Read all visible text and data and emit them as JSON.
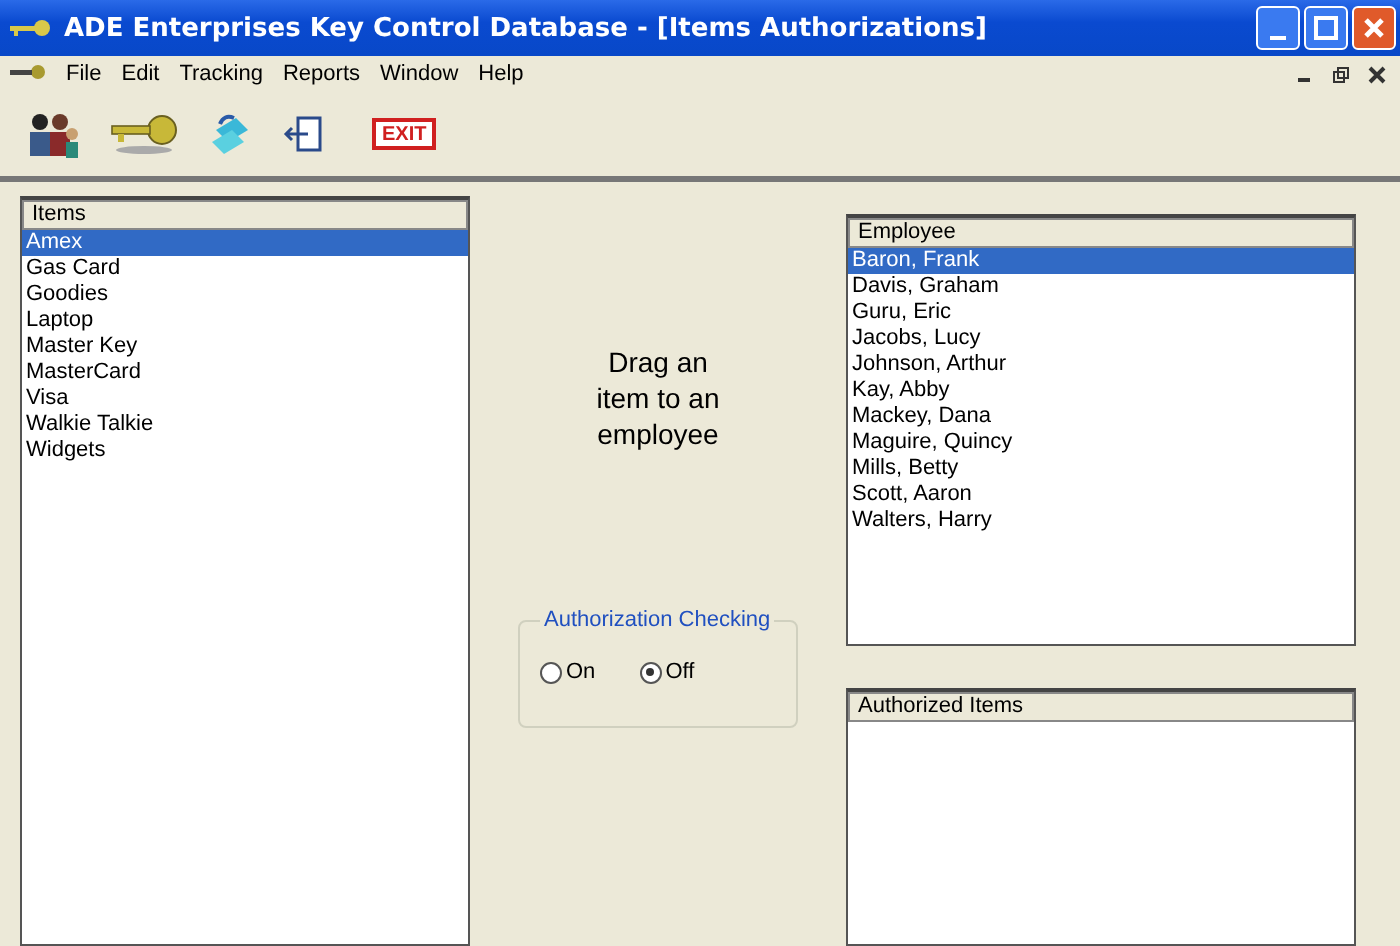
{
  "window": {
    "title": "ADE Enterprises Key Control Database - [Items Authorizations]"
  },
  "menu": [
    "File",
    "Edit",
    "Tracking",
    "Reports",
    "Window",
    "Help"
  ],
  "items": {
    "header": "Items",
    "rows": [
      {
        "label": "Amex",
        "selected": true
      },
      {
        "label": "Gas Card",
        "selected": false
      },
      {
        "label": "Goodies",
        "selected": false
      },
      {
        "label": "Laptop",
        "selected": false
      },
      {
        "label": "Master Key",
        "selected": false
      },
      {
        "label": "MasterCard",
        "selected": false
      },
      {
        "label": "Visa",
        "selected": false
      },
      {
        "label": "Walkie Talkie",
        "selected": false
      },
      {
        "label": "Widgets",
        "selected": false
      }
    ]
  },
  "instruction": "Drag an item to an employee",
  "authorization_checking": {
    "title": "Authorization Checking",
    "options": [
      {
        "label": "On",
        "selected": false
      },
      {
        "label": "Off",
        "selected": true
      }
    ]
  },
  "employees": {
    "header": "Employee",
    "rows": [
      {
        "label": "Baron, Frank",
        "selected": true
      },
      {
        "label": "Davis, Graham",
        "selected": false
      },
      {
        "label": "Guru, Eric",
        "selected": false
      },
      {
        "label": "Jacobs, Lucy",
        "selected": false
      },
      {
        "label": "Johnson, Arthur",
        "selected": false
      },
      {
        "label": "Kay, Abby",
        "selected": false
      },
      {
        "label": "Mackey, Dana",
        "selected": false
      },
      {
        "label": "Maguire, Quincy",
        "selected": false
      },
      {
        "label": "Mills, Betty",
        "selected": false
      },
      {
        "label": "Scott, Aaron",
        "selected": false
      },
      {
        "label": "Walters, Harry",
        "selected": false
      }
    ]
  },
  "authorized_items": {
    "header": "Authorized Items"
  },
  "toolbar_exit": "EXIT"
}
